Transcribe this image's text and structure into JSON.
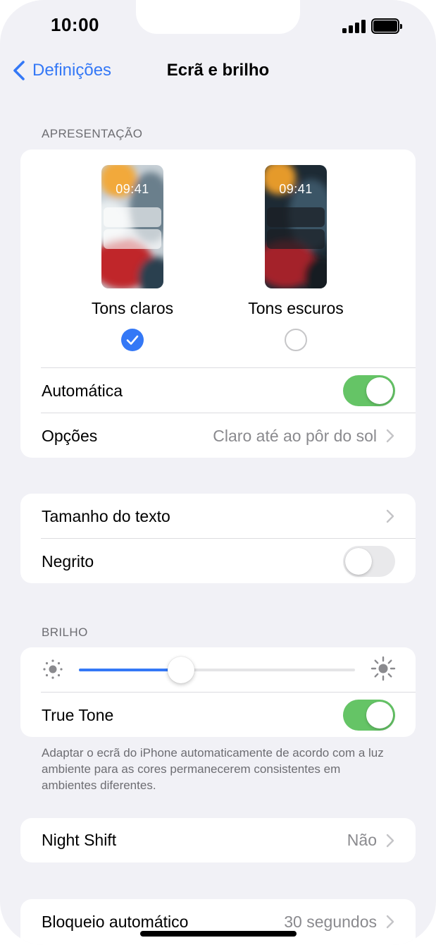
{
  "status_bar": {
    "time": "10:00"
  },
  "nav": {
    "back_label": "Definições",
    "title": "Ecrã e brilho"
  },
  "appearance": {
    "header": "APRESENTAÇÃO",
    "preview_time": "09:41",
    "light_label": "Tons claros",
    "dark_label": "Tons escuros",
    "selected": "light",
    "automatic_label": "Automática",
    "automatic_on": true,
    "options_label": "Opções",
    "options_value": "Claro até ao pôr do sol"
  },
  "text": {
    "text_size_label": "Tamanho do texto",
    "bold_label": "Negrito",
    "bold_on": false
  },
  "brightness": {
    "header": "BRILHO",
    "level_percent": 37,
    "true_tone_label": "True Tone",
    "true_tone_on": true,
    "footnote": "Adaptar o ecrã do iPhone automaticamente de acordo com a luz ambiente para as cores permanecerem consistentes em ambientes diferentes."
  },
  "night_shift": {
    "label": "Night Shift",
    "value": "Não"
  },
  "auto_lock": {
    "label": "Bloqueio automático",
    "value": "30 segundos"
  },
  "colors": {
    "accent": "#3478f6",
    "toggle_on": "#65c466",
    "toggle_off": "#e9e9eb",
    "background": "#f1f1f6"
  },
  "icons": {
    "back": "chevron-left-icon",
    "disclosure": "chevron-right-icon",
    "check": "checkmark-icon",
    "sun_small": "sun-min-icon",
    "sun_large": "sun-max-icon"
  }
}
